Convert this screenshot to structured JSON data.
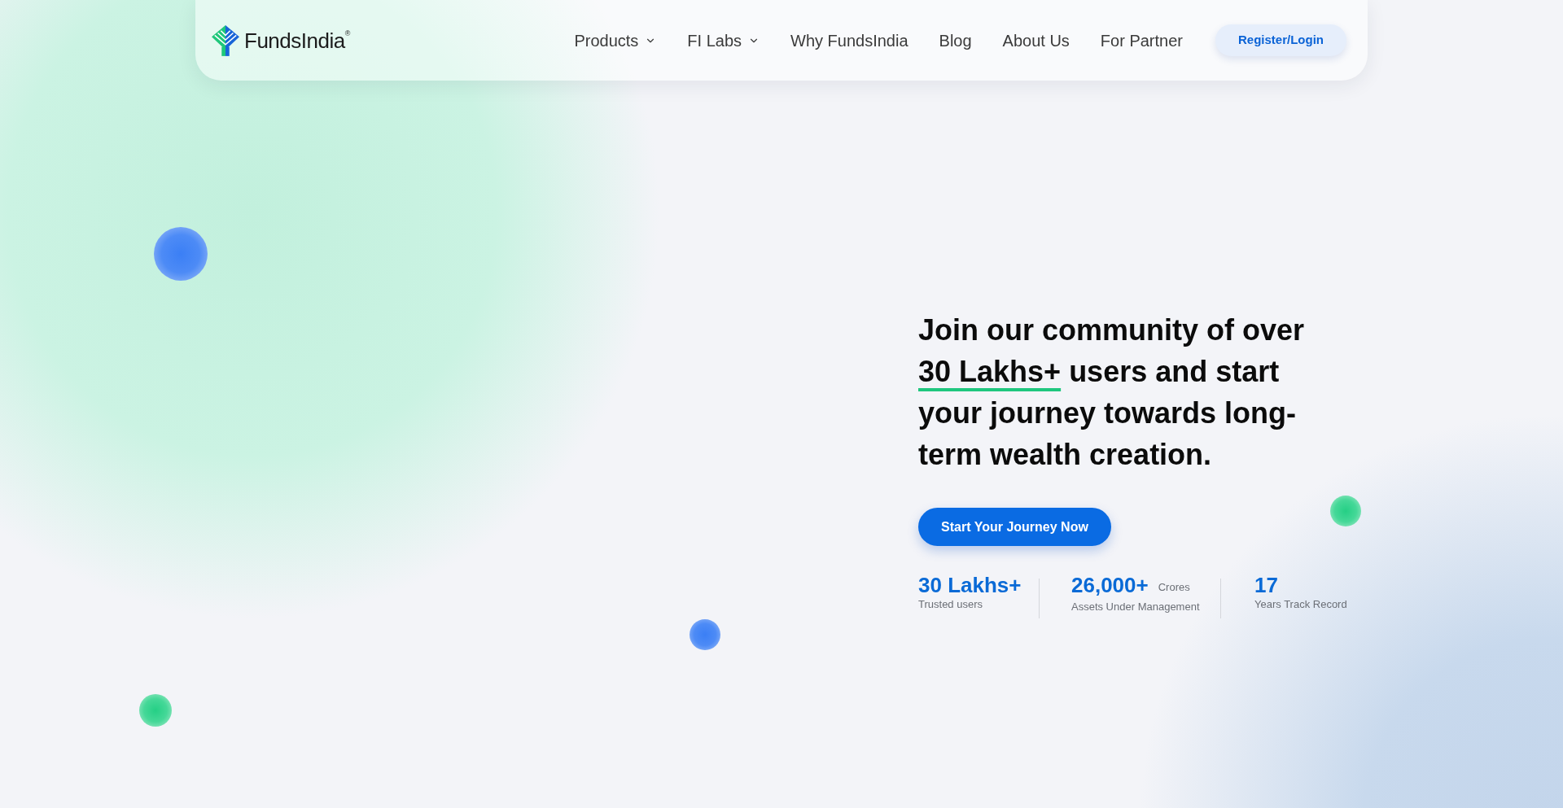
{
  "logo": {
    "text": "FundsIndia$^{®}$"
  },
  "nav": {
    "items": [
      {
        "label": "Products",
        "kind": "dropdown"
      },
      {
        "label": "FI Labs",
        "kind": "dropdown"
      },
      {
        "label": "Why FundsIndia",
        "kind": "link"
      },
      {
        "label": "Blog",
        "kind": "link"
      },
      {
        "label": "About Us",
        "kind": "link"
      },
      {
        "label": "For Partner",
        "kind": "link"
      }
    ],
    "login_button": "Register/Login"
  },
  "hero": {
    "headline": [
      {
        "text": "Join our community of over ",
        "underlined": false
      },
      {
        "text": "30 Lakhs+",
        "underlined": true
      },
      {
        "text": " users and start your journey towards long-term wealth creation.",
        "underlined": false
      }
    ],
    "cta_button": "Start Your Journey Now",
    "stats": [
      {
        "value": "30 Lakhs+",
        "label": "Trusted users"
      },
      {
        "value": "26,000+",
        "unit": "Crores",
        "label": "Assets Under Management"
      },
      {
        "value": "17",
        "label": "Years Track Record"
      }
    ]
  }
}
